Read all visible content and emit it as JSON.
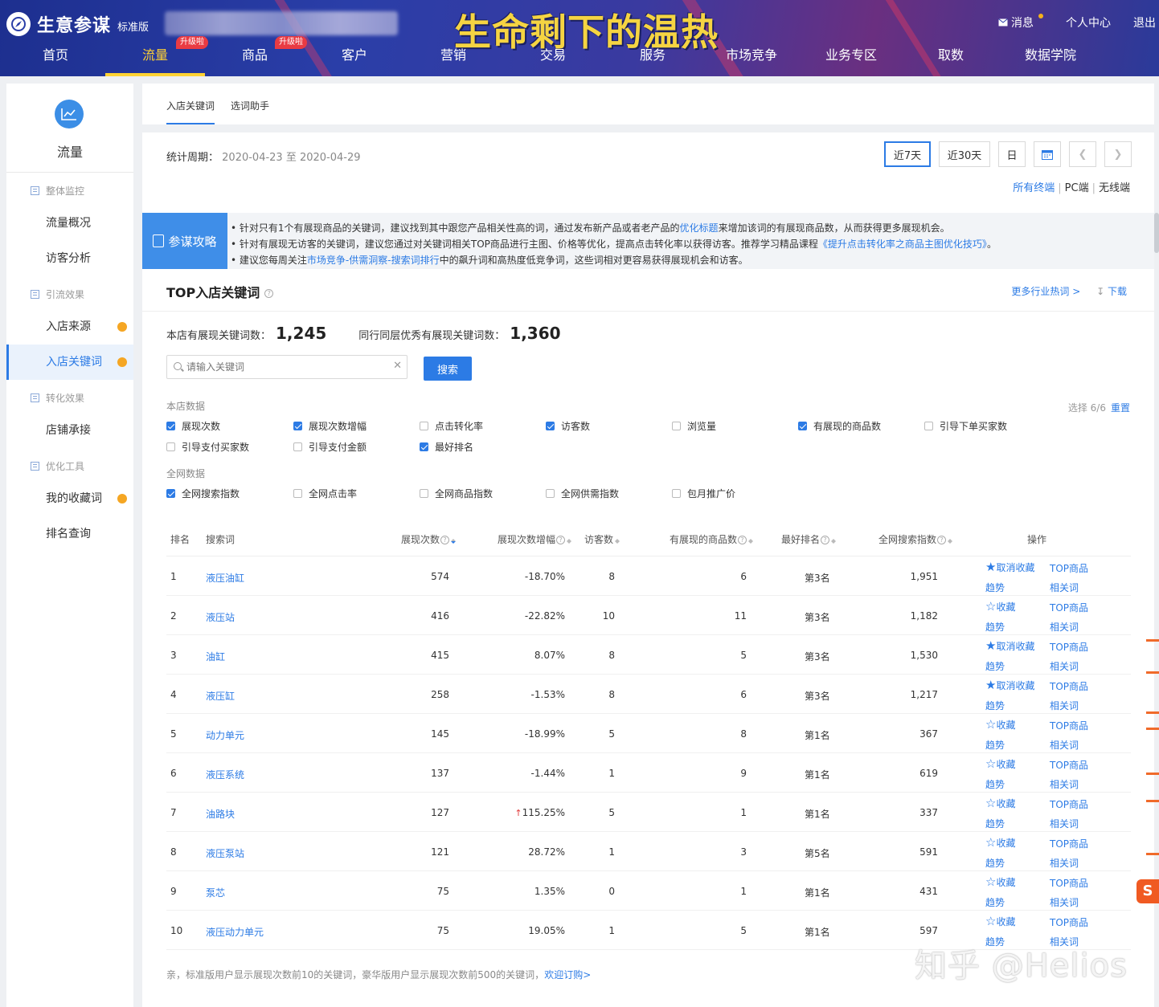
{
  "header": {
    "app_title": "生意参谋",
    "edition": "标准版",
    "banner_text": "生命剩下的温热",
    "messages": "消息",
    "user_center": "个人中心",
    "logout": "退出",
    "nav": [
      {
        "label": "首页",
        "badge": ""
      },
      {
        "label": "流量",
        "badge": "升级啦",
        "active": true
      },
      {
        "label": "商品",
        "badge": "升级啦"
      },
      {
        "label": "客户",
        "badge": ""
      },
      {
        "label": "营销",
        "badge": ""
      },
      {
        "label": "交易",
        "badge": ""
      },
      {
        "label": "服务",
        "badge": ""
      },
      {
        "label": "市场竞争",
        "badge": ""
      },
      {
        "label": "业务专区",
        "badge": ""
      },
      {
        "label": "取数",
        "badge": ""
      },
      {
        "label": "数据学院",
        "badge": ""
      }
    ]
  },
  "sidebar": {
    "title": "流量",
    "groups": [
      {
        "label": "整体监控",
        "items": [
          {
            "label": "流量概况"
          },
          {
            "label": "访客分析"
          }
        ]
      },
      {
        "label": "引流效果",
        "items": [
          {
            "label": "入店来源",
            "dot": true
          },
          {
            "label": "入店关键词",
            "dot": true,
            "active": true
          }
        ]
      },
      {
        "label": "转化效果",
        "items": [
          {
            "label": "店铺承接"
          }
        ]
      },
      {
        "label": "优化工具",
        "items": [
          {
            "label": "我的收藏词",
            "dot": true
          },
          {
            "label": "排名查询"
          }
        ]
      }
    ]
  },
  "tabs": [
    "入店关键词",
    "选词助手"
  ],
  "period": {
    "label": "统计周期：",
    "value": "2020-04-23 至 2020-04-29",
    "buttons": [
      "近7天",
      "近30天",
      "日"
    ],
    "devices": [
      "所有终端",
      "PC端",
      "无线端"
    ]
  },
  "tips": {
    "label": "参谋攻略",
    "lines": [
      {
        "pre": "• 针对只有1个有展现商品的关键词，建议找到其中跟您产品相关性高的词，通过发布新产品或者老产品的",
        "link": "优化标题",
        "post": "来增加该词的有展现商品数，从而获得更多展现机会。"
      },
      {
        "pre": "• 针对有展现无访客的关键词，建议您通过对关键词相关TOP商品进行主图、价格等优化，提高点击转化率以获得访客。推荐学习精品课程",
        "link": "《提升点击转化率之商品主图优化技巧》",
        "post": "。"
      },
      {
        "pre": "• 建议您每周关注",
        "link": "市场竞争-供需洞察-搜索词排行",
        "post": "中的飙升词和高热度低竞争词，这些词相对更容易获得展现机会和访客。"
      }
    ]
  },
  "section": {
    "title": "TOP入店关键词",
    "more_link": "更多行业热词 >",
    "download": "下载",
    "own_label": "本店有展现关键词数：",
    "own_count": "1,245",
    "peer_label": "同行同层优秀有展现关键词数：",
    "peer_count": "1,360",
    "search_placeholder": "请输入关键词",
    "search_button": "搜索",
    "store_group": "本店数据",
    "net_group": "全网数据",
    "selected_info": "选择 6/6",
    "reset": "重置",
    "store_metrics": [
      {
        "label": "展现次数",
        "on": true
      },
      {
        "label": "展现次数增幅",
        "on": true
      },
      {
        "label": "点击转化率",
        "on": false
      },
      {
        "label": "访客数",
        "on": true
      },
      {
        "label": "浏览量",
        "on": false
      },
      {
        "label": "有展现的商品数",
        "on": true
      },
      {
        "label": "引导下单买家数",
        "on": false
      },
      {
        "label": "引导支付买家数",
        "on": false
      },
      {
        "label": "引导支付金额",
        "on": false
      },
      {
        "label": "最好排名",
        "on": true
      }
    ],
    "net_metrics": [
      {
        "label": "全网搜索指数",
        "on": true
      },
      {
        "label": "全网点击率",
        "on": false
      },
      {
        "label": "全网商品指数",
        "on": false
      },
      {
        "label": "全网供需指数",
        "on": false
      },
      {
        "label": "包月推广价",
        "on": false
      }
    ]
  },
  "table": {
    "headers": [
      "排名",
      "搜索词",
      "展现次数",
      "展现次数增幅",
      "访客数",
      "有展现的商品数",
      "最好排名",
      "全网搜索指数",
      "操作"
    ],
    "rows": [
      {
        "rank": "1",
        "keyword": "液压油缸",
        "impressions": "574",
        "growth": "-18.70%",
        "visitors": "8",
        "products": "6",
        "best": "第3名",
        "index": "1,951",
        "fav": "取消收藏",
        "starred": true
      },
      {
        "rank": "2",
        "keyword": "液压站",
        "impressions": "416",
        "growth": "-22.82%",
        "visitors": "10",
        "products": "11",
        "best": "第3名",
        "index": "1,182",
        "fav": "收藏",
        "starred": false
      },
      {
        "rank": "3",
        "keyword": "油缸",
        "impressions": "415",
        "growth": "8.07%",
        "visitors": "8",
        "products": "5",
        "best": "第3名",
        "index": "1,530",
        "fav": "取消收藏",
        "starred": true
      },
      {
        "rank": "4",
        "keyword": "液压缸",
        "impressions": "258",
        "growth": "-1.53%",
        "visitors": "8",
        "products": "6",
        "best": "第3名",
        "index": "1,217",
        "fav": "取消收藏",
        "starred": true
      },
      {
        "rank": "5",
        "keyword": "动力单元",
        "impressions": "145",
        "growth": "-18.99%",
        "visitors": "5",
        "products": "8",
        "best": "第1名",
        "index": "367",
        "fav": "收藏",
        "starred": false
      },
      {
        "rank": "6",
        "keyword": "液压系统",
        "impressions": "137",
        "growth": "-1.44%",
        "visitors": "1",
        "products": "9",
        "best": "第1名",
        "index": "619",
        "fav": "收藏",
        "starred": false
      },
      {
        "rank": "7",
        "keyword": "油路块",
        "impressions": "127",
        "growth": "115.25%",
        "visitors": "5",
        "products": "1",
        "best": "第1名",
        "index": "337",
        "fav": "收藏",
        "starred": false,
        "surge": true
      },
      {
        "rank": "8",
        "keyword": "液压泵站",
        "impressions": "121",
        "growth": "28.72%",
        "visitors": "1",
        "products": "3",
        "best": "第5名",
        "index": "591",
        "fav": "收藏",
        "starred": false
      },
      {
        "rank": "9",
        "keyword": "泵芯",
        "impressions": "75",
        "growth": "1.35%",
        "visitors": "0",
        "products": "1",
        "best": "第1名",
        "index": "431",
        "fav": "收藏",
        "starred": false
      },
      {
        "rank": "10",
        "keyword": "液压动力单元",
        "impressions": "75",
        "growth": "19.05%",
        "visitors": "1",
        "products": "5",
        "best": "第1名",
        "index": "597",
        "fav": "收藏",
        "starred": false
      }
    ],
    "op_top": "TOP商品",
    "op_trend": "趋势",
    "op_related": "相关词"
  },
  "footnote": {
    "text": "亲，标准版用户显示展现次数前10的关键词，豪华版用户显示展现次数前500的关键词，",
    "link": "欢迎订购>"
  },
  "watermark": "知乎 @Helios",
  "colors": {
    "accent": "#2c7be5",
    "nav_active": "#ffd233",
    "dot": "#f5a623",
    "badge": "#e93b43"
  }
}
